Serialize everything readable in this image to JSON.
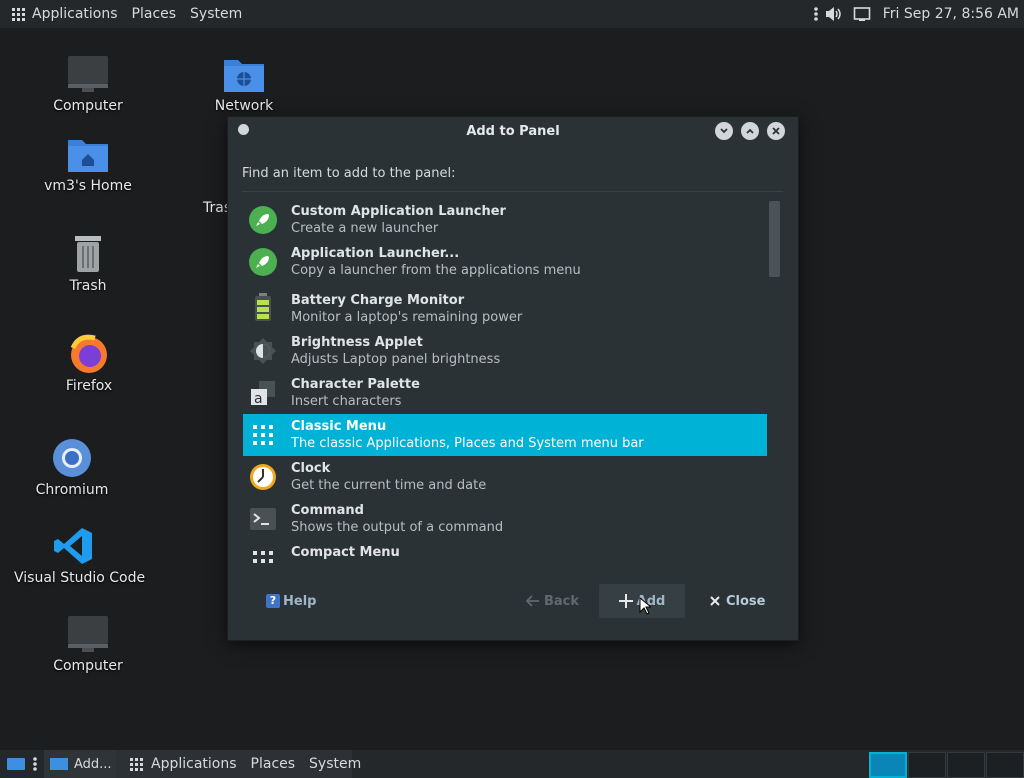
{
  "top_panel": {
    "menus": [
      "Applications",
      "Places",
      "System"
    ],
    "clock": "Fri Sep 27,  8:56 AM"
  },
  "desktop": {
    "icons": [
      {
        "label": "Computer",
        "icon": "monitor-icon"
      },
      {
        "label": "Network",
        "icon": "network-folder-icon"
      },
      {
        "label": "vm3's Home",
        "icon": "home-folder-icon"
      },
      {
        "label": "Tras",
        "icon": "trash-partial-icon"
      },
      {
        "label": "Trash",
        "icon": "trash-icon"
      },
      {
        "label": "Firefox",
        "icon": "firefox-icon"
      },
      {
        "label": "Chromium",
        "icon": "chromium-icon"
      },
      {
        "label": "Visual Studio Code",
        "icon": "vscode-icon"
      },
      {
        "label": "Computer",
        "icon": "monitor-icon"
      }
    ]
  },
  "dialog": {
    "title": "Add to Panel",
    "find_label": "Find an item to add to the panel:",
    "items": [
      {
        "name": "Custom Application Launcher",
        "desc": "Create a new launcher",
        "icon": "rocket-icon"
      },
      {
        "name": "Application Launcher...",
        "desc": "Copy a launcher from the applications menu",
        "icon": "rocket-icon"
      },
      {
        "name": "Battery Charge Monitor",
        "desc": "Monitor a laptop's remaining power",
        "icon": "battery-icon"
      },
      {
        "name": "Brightness Applet",
        "desc": "Adjusts Laptop panel brightness",
        "icon": "brightness-icon"
      },
      {
        "name": "Character Palette",
        "desc": "Insert characters",
        "icon": "character-icon"
      },
      {
        "name": "Classic Menu",
        "desc": "The classic Applications, Places and System menu bar",
        "icon": "grid-menu-icon",
        "selected": true
      },
      {
        "name": "Clock",
        "desc": "Get the current time and date",
        "icon": "clock-icon"
      },
      {
        "name": "Command",
        "desc": "Shows the output of a command",
        "icon": "terminal-icon"
      },
      {
        "name": "Compact Menu",
        "desc": "",
        "icon": "grid-menu-icon"
      }
    ],
    "buttons": {
      "help": "Help",
      "help_glyph": "?",
      "back": "Back",
      "add": "Add",
      "close": "Close"
    },
    "colors": {
      "selection": "#00b2d6",
      "background": "#2b3236"
    }
  },
  "bottom_panel": {
    "task_label": "Add...",
    "menus": [
      "Applications",
      "Places",
      "System"
    ],
    "workspaces": 4,
    "active_workspace": 1
  }
}
